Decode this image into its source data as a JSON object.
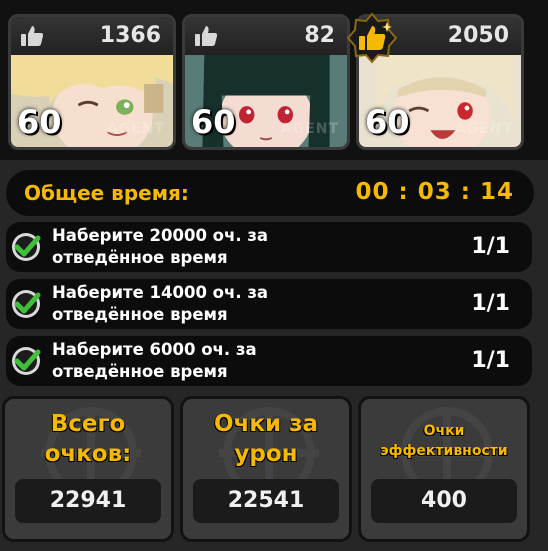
{
  "agents": [
    {
      "likes": "1366",
      "level": "60",
      "tag": "AGENT",
      "mvp": false,
      "hair": "#f1dc9a",
      "skin": "#f7dfcf",
      "bg": "#d9d0b8",
      "eye": "#7db05a"
    },
    {
      "likes": "82",
      "level": "60",
      "tag": "AGENT",
      "mvp": false,
      "hair": "#16302c",
      "skin": "#f5dcd2",
      "bg": "#5a7c78",
      "eye": "#c02434"
    },
    {
      "likes": "2050",
      "level": "60",
      "tag": "AGENT",
      "mvp": true,
      "hair": "#efe4c8",
      "skin": "#f8e1d2",
      "bg": "#e9e2d0",
      "eye": "#c8282e"
    }
  ],
  "total_time": {
    "label": "Общее время:",
    "value": "00 : 03 : 14"
  },
  "objectives": [
    {
      "line1": "Наберите 20000 оч. за",
      "line2": "отведённое время",
      "progress": "1/1"
    },
    {
      "line1": "Наберите 14000 оч. за",
      "line2": "отведённое время",
      "progress": "1/1"
    },
    {
      "line1": "Наберите 6000 оч. за",
      "line2": "отведённое время",
      "progress": "1/1"
    }
  ],
  "panels": [
    {
      "title_line1": "Всего",
      "title_line2": "очков:",
      "value": "22941"
    },
    {
      "title_line1": "Очки за",
      "title_line2": "урон",
      "value": "22541"
    },
    {
      "title_line1": "Очки",
      "title_line2": "эффективности",
      "value": "400"
    }
  ],
  "colors": {
    "accent": "#f6b800",
    "check_green": "#3fbf3a",
    "panel_bg": "#3b3b3b",
    "bar_bg": "#0c0c0c"
  },
  "icons": {
    "like": "thumbs-up-icon",
    "mvp": "mvp-thumbs-up-badge-icon",
    "done": "checkmark-circle-icon"
  }
}
